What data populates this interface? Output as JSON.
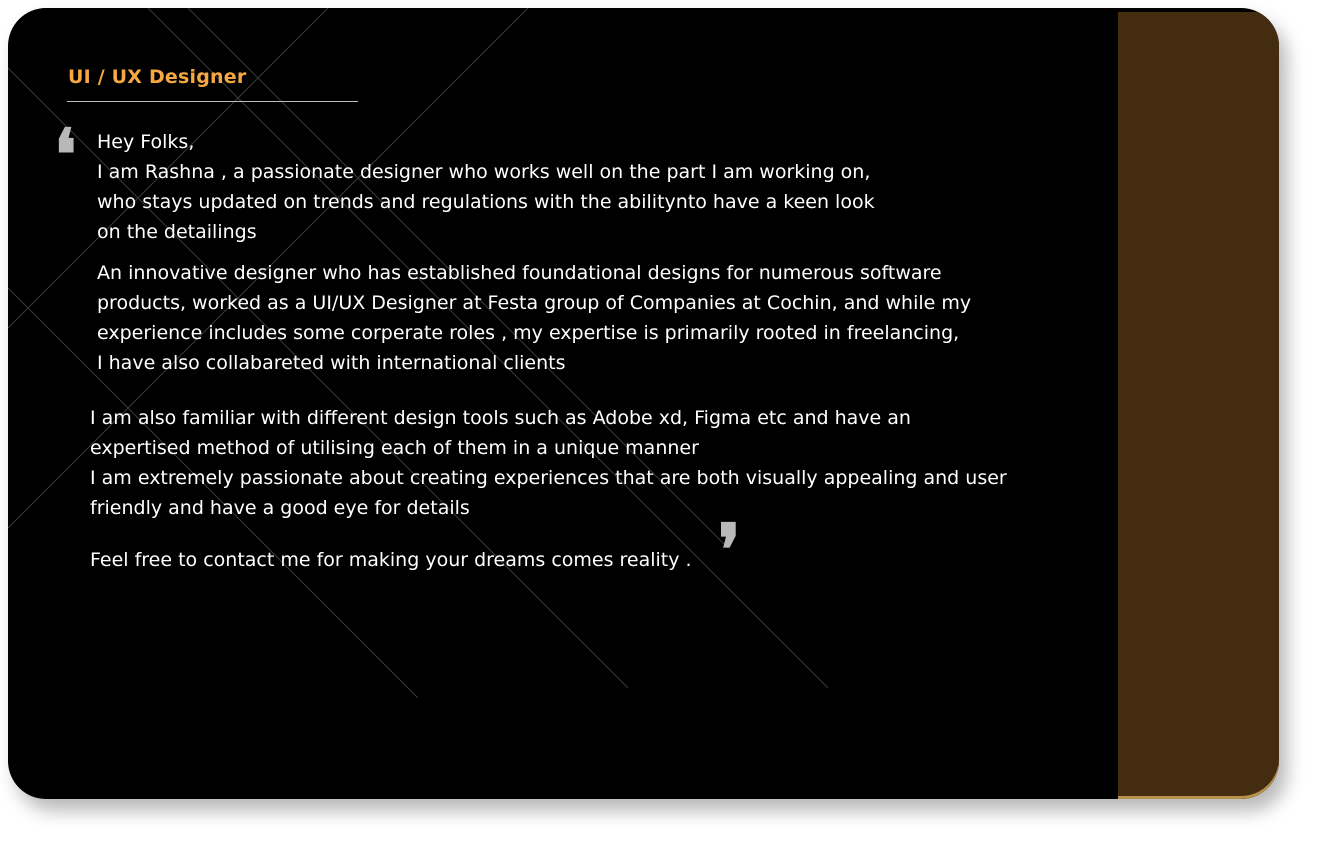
{
  "profile": {
    "role_title": "UI / UX Designer",
    "accent_color": "#f5a742",
    "side_panel_color": "#442c10"
  },
  "quote": {
    "open_mark": "❛",
    "close_mark": "❜"
  },
  "bio": {
    "intro_lines": [
      "Hey Folks,",
      "I am Rashna , a passionate designer who works well on the part I am working on,",
      "who stays updated on trends and regulations with the abilitynto have a keen look",
      "on the detailings"
    ],
    "experience_lines": [
      "An innovative designer who has established foundational designs for numerous software",
      "products, worked as a UI/UX Designer at Festa group of Companies at Cochin, and while my",
      "experience includes some corperate roles , my expertise is primarily rooted in freelancing,",
      "I have also collabareted with international clients"
    ],
    "tools_lines": [
      "I am also familiar with different design tools such as Adobe xd, Figma etc and have an",
      "expertised method of utilising each of them in a unique manner",
      "I am extremely passionate about creating experiences that are both visually appealing and user",
      "friendly and have a good eye for details"
    ],
    "closing_line": "Feel free to contact me for making your dreams comes reality ."
  }
}
